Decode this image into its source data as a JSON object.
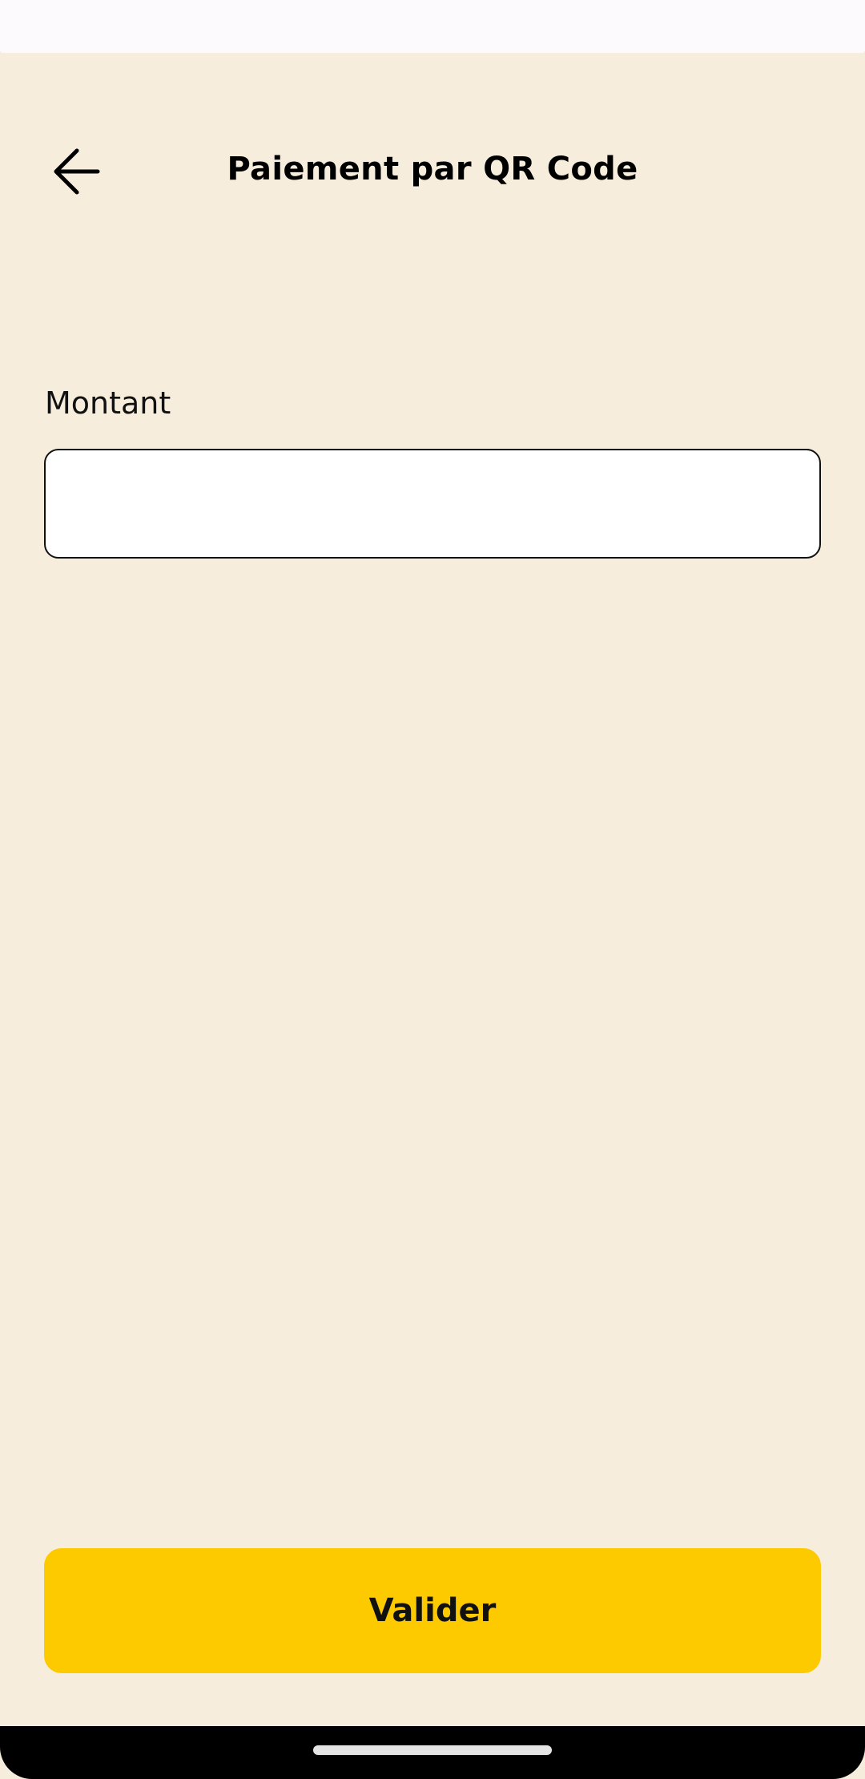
{
  "header": {
    "title": "Paiement par QR Code",
    "back_icon": "arrow-left-icon"
  },
  "form": {
    "amount_label": "Montant",
    "amount_value": "",
    "amount_placeholder": ""
  },
  "actions": {
    "validate_label": "Valider"
  },
  "colors": {
    "background": "#F6EDDC",
    "accent": "#FDCA00",
    "input_background": "#FFFFFF",
    "text": "#000000"
  }
}
